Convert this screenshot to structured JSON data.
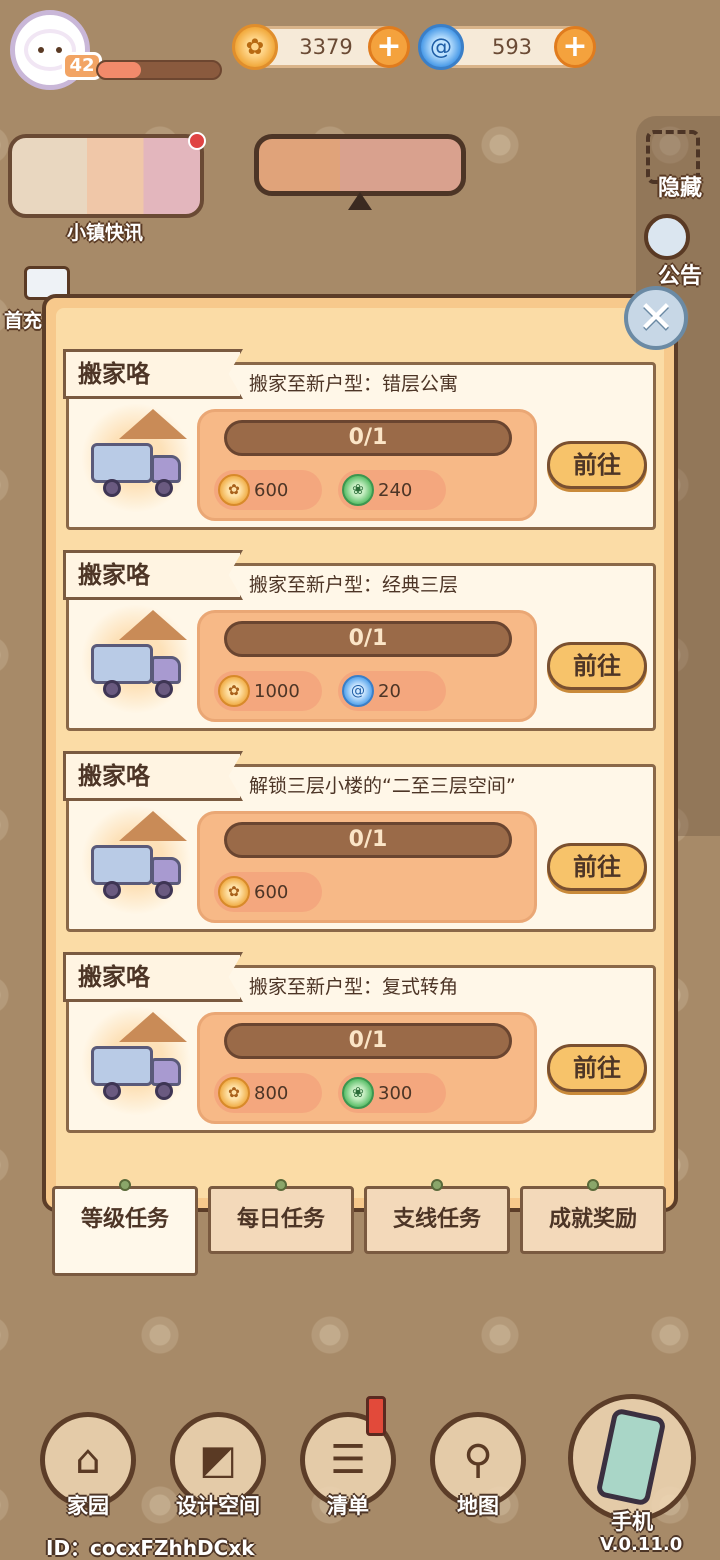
{
  "player": {
    "level": "42",
    "xp_fraction": 0.35
  },
  "currency": {
    "gold": "3379",
    "gems": "593"
  },
  "hud": {
    "news_label": "小镇快讯",
    "first_charge_label": "首充",
    "hide_label": "隐藏",
    "notice_label": "公告"
  },
  "tasks": [
    {
      "tag": "搬家咯",
      "desc": "搬家至新户型：错层公寓",
      "progress": "0/1",
      "rewards": [
        {
          "icon": "gold-coin-icon",
          "amount": "600"
        },
        {
          "icon": "leaf-icon",
          "amount": "240"
        }
      ],
      "go": "前往"
    },
    {
      "tag": "搬家咯",
      "desc": "搬家至新户型：经典三层",
      "progress": "0/1",
      "rewards": [
        {
          "icon": "gold-coin-icon",
          "amount": "1000"
        },
        {
          "icon": "gem-icon",
          "amount": "20"
        }
      ],
      "go": "前往"
    },
    {
      "tag": "搬家咯",
      "desc": "解锁三层小楼的“二至三层空间”",
      "progress": "0/1",
      "rewards": [
        {
          "icon": "gold-coin-icon",
          "amount": "600"
        }
      ],
      "go": "前往"
    },
    {
      "tag": "搬家咯",
      "desc": "搬家至新户型：复式转角",
      "progress": "0/1",
      "rewards": [
        {
          "icon": "gold-coin-icon",
          "amount": "800"
        },
        {
          "icon": "leaf-icon",
          "amount": "300"
        }
      ],
      "go": "前往"
    }
  ],
  "tabs": [
    {
      "label": "等级任务",
      "active": true
    },
    {
      "label": "每日任务",
      "active": false
    },
    {
      "label": "支线任务",
      "active": false
    },
    {
      "label": "成就奖励",
      "active": false
    }
  ],
  "nav": [
    {
      "label": "家园",
      "icon": "house-icon"
    },
    {
      "label": "设计空间",
      "icon": "design-ruler-icon"
    },
    {
      "label": "清单",
      "icon": "checklist-icon"
    },
    {
      "label": "地图",
      "icon": "map-pin-icon"
    },
    {
      "label": "手机",
      "icon": "phone-icon"
    }
  ],
  "footer": {
    "id": "ID：cocxFZhhDCxk",
    "version": "V.0.11.0"
  },
  "colors": {
    "accent": "#f7c36a",
    "panel": "#fbdca6",
    "border": "#5c3d28"
  }
}
